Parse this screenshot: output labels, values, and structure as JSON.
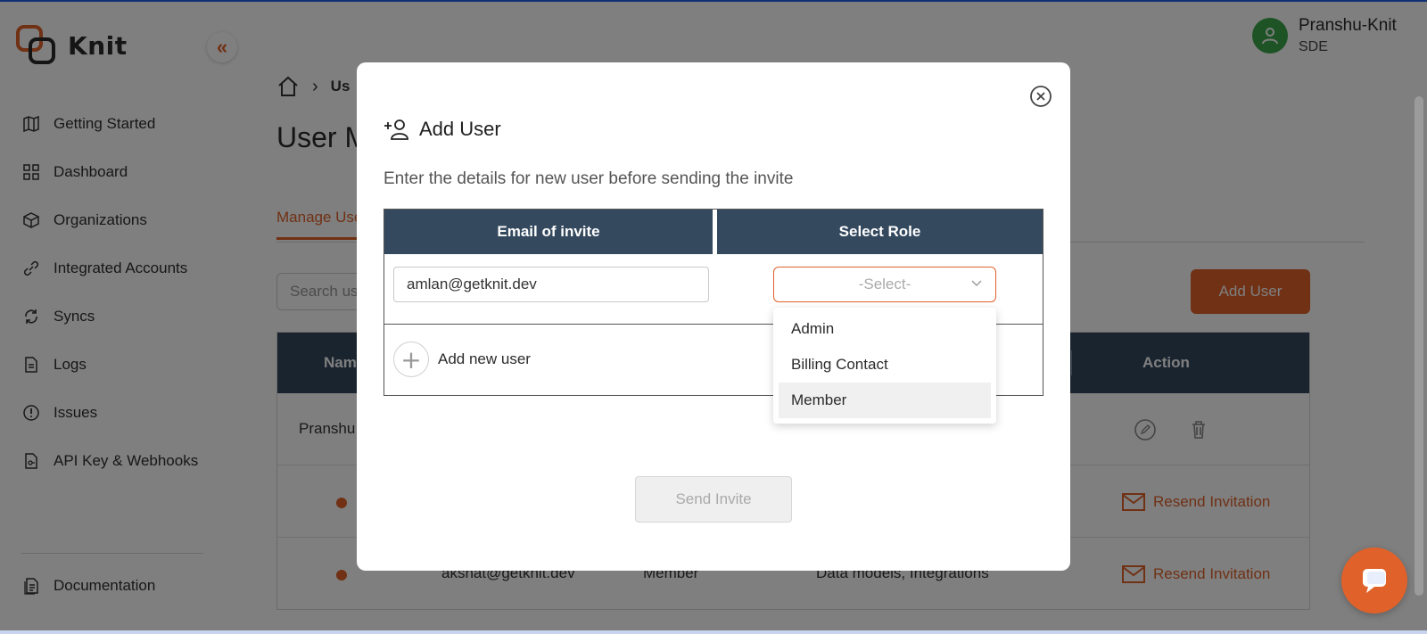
{
  "app": {
    "name": "Knit"
  },
  "user": {
    "name": "Pranshu-Knit",
    "role": "SDE"
  },
  "sidebar": {
    "items": [
      {
        "label": "Getting Started",
        "icon": "map-icon"
      },
      {
        "label": "Dashboard",
        "icon": "grid-icon"
      },
      {
        "label": "Organizations",
        "icon": "cube-icon"
      },
      {
        "label": "Integrated Accounts",
        "icon": "link-icon"
      },
      {
        "label": "Syncs",
        "icon": "sync-icon"
      },
      {
        "label": "Logs",
        "icon": "file-icon"
      },
      {
        "label": "Issues",
        "icon": "alert-icon"
      },
      {
        "label": "API Key & Webhooks",
        "icon": "key-file-icon"
      }
    ],
    "documentation": "Documentation"
  },
  "main": {
    "breadcrumb": "Us",
    "page_title": "User M",
    "tab_active": "Manage Use",
    "search_placeholder": "Search use",
    "add_user_button": "Add User",
    "table": {
      "headers": {
        "name": "Nam",
        "action": "Action"
      },
      "rows": [
        {
          "name": "Pranshu"
        },
        {
          "status": "pending",
          "action": "Resend Invitation"
        },
        {
          "status": "pending",
          "email": "akshat@getknit.dev",
          "role": "Member",
          "permissions": "Data models, Integrations",
          "action": "Resend Invitation"
        }
      ]
    }
  },
  "modal": {
    "title": "Add User",
    "subtitle": "Enter the details for new user before sending the invite",
    "col_email": "Email of invite",
    "col_role": "Select Role",
    "email_value": "amlan@getknit.dev",
    "role_placeholder": "-Select-",
    "role_options": [
      "Admin",
      "Billing Contact",
      "Member"
    ],
    "highlighted_option": "Member",
    "add_new_user": "Add new user",
    "send_invite": "Send Invite"
  },
  "colors": {
    "accent": "#e0622a",
    "header": "#34495e",
    "avatar": "#3aa64b"
  }
}
